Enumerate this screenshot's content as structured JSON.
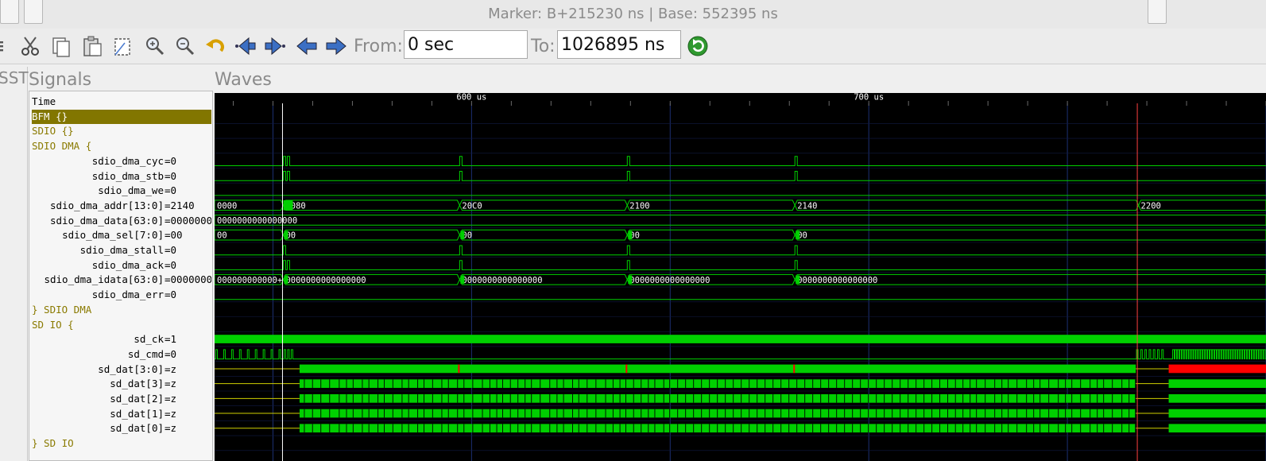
{
  "window": {
    "title": "Marker: B+215230 ns  |  Base: 552395 ns"
  },
  "toolbar": {
    "from_label": "From:",
    "from_value": "0 sec",
    "to_label": "To:",
    "to_value": "1026895 ns",
    "icons": [
      "menu-icon",
      "cut-icon",
      "copy-icon",
      "paste-icon",
      "select-all-icon",
      "zoom-in-icon",
      "zoom-out-icon",
      "undo-icon",
      "jump-first-icon",
      "jump-last-icon",
      "nav-left-icon",
      "nav-right-icon",
      "reload-icon"
    ]
  },
  "sst": {
    "label": "SST"
  },
  "signals": {
    "title": "Signals",
    "rows": [
      {
        "name": "Time",
        "value": "",
        "kind": "time"
      },
      {
        "name": "BFM {}",
        "value": "",
        "kind": "group-selected"
      },
      {
        "name": "SDIO {}",
        "value": "",
        "kind": "group"
      },
      {
        "name": "SDIO DMA {",
        "value": "",
        "kind": "group"
      },
      {
        "name": "sdio_dma_cyc",
        "value": "=0",
        "kind": "sig"
      },
      {
        "name": "sdio_dma_stb",
        "value": "=0",
        "kind": "sig"
      },
      {
        "name": "sdio_dma_we",
        "value": "=0",
        "kind": "sig"
      },
      {
        "name": "sdio_dma_addr[13:0]",
        "value": "=2140",
        "kind": "sig"
      },
      {
        "name": "sdio_dma_data[63:0]",
        "value": "=0000000",
        "kind": "sig"
      },
      {
        "name": "sdio_dma_sel[7:0]",
        "value": "=00",
        "kind": "sig"
      },
      {
        "name": "sdio_dma_stall",
        "value": "=0",
        "kind": "sig"
      },
      {
        "name": "sdio_dma_ack",
        "value": "=0",
        "kind": "sig"
      },
      {
        "name": "sdio_dma_idata[63:0]",
        "value": "=0000000",
        "kind": "sig"
      },
      {
        "name": "sdio_dma_err",
        "value": "=0",
        "kind": "sig"
      },
      {
        "name": "} SDIO DMA",
        "value": "",
        "kind": "group"
      },
      {
        "name": "SD IO {",
        "value": "",
        "kind": "group"
      },
      {
        "name": "sd_ck",
        "value": "=1",
        "kind": "sig"
      },
      {
        "name": "sd_cmd",
        "value": "=0",
        "kind": "sig"
      },
      {
        "name": "sd_dat[3:0]",
        "value": "=z",
        "kind": "sig"
      },
      {
        "name": "sd_dat[3]",
        "value": "=z",
        "kind": "sig"
      },
      {
        "name": "sd_dat[2]",
        "value": "=z",
        "kind": "sig"
      },
      {
        "name": "sd_dat[1]",
        "value": "=z",
        "kind": "sig"
      },
      {
        "name": "sd_dat[0]",
        "value": "=z",
        "kind": "sig"
      },
      {
        "name": "} SD IO",
        "value": "",
        "kind": "group"
      }
    ]
  },
  "waves": {
    "title": "Waves",
    "time_labels": [
      {
        "label": "600 us",
        "t": 600
      },
      {
        "label": "700 us",
        "t": 700
      }
    ],
    "view_start_us": 535.3,
    "view_end_us": 800.0,
    "cursor_us": 552.4,
    "marker_us": 767.6,
    "edges_us": [
      552.6,
      597.0,
      639.2,
      681.4
    ],
    "bus_labels": {
      "addr": [
        "0000",
        "2080",
        "20C0",
        "2100",
        "2140",
        "2200"
      ],
      "data": [
        "0000000000000000"
      ],
      "sel": [
        "00",
        "00",
        "00",
        "00",
        "00"
      ],
      "idata": [
        "000000000000+",
        "0000000000000000",
        "0000000000000000",
        "0000000000000000",
        "0000000000000000"
      ]
    },
    "colors": {
      "background": "#000000",
      "signal": "#00d000",
      "highz": "#d0d000",
      "cursor": "#ffffff",
      "marker": "#ff4040",
      "error": "#ff0000",
      "gridline": "#1c2f72"
    }
  }
}
